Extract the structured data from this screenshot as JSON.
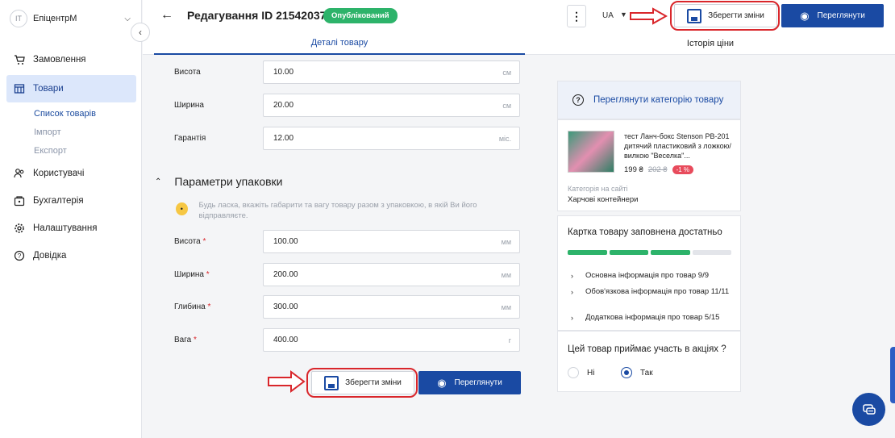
{
  "sidebar": {
    "org_initials": "IT",
    "org_name": "ЕпіцентрМ",
    "items": [
      {
        "label": "Замовлення",
        "icon": "cart-icon"
      },
      {
        "label": "Товари",
        "icon": "box-icon"
      },
      {
        "label": "Користувачі",
        "icon": "users-icon"
      },
      {
        "label": "Бухгалтерія",
        "icon": "wallet-icon"
      },
      {
        "label": "Налаштування",
        "icon": "gear-icon"
      },
      {
        "label": "Довідка",
        "icon": "help-icon"
      }
    ],
    "subitems": [
      "Список товарів",
      "Імпорт",
      "Експорт"
    ]
  },
  "header": {
    "title": "Редагування ID 21542037",
    "status_badge": "Опублікований",
    "lang": "UA",
    "save_label": "Зберегти зміни",
    "view_label": "Переглянути"
  },
  "tabs": [
    "Деталі товару",
    "Історія ціни"
  ],
  "dimensions": [
    {
      "label": "Висота",
      "value": "10.00",
      "unit": "см"
    },
    {
      "label": "Ширина",
      "value": "20.00",
      "unit": "см"
    },
    {
      "label": "Гарантія",
      "value": "12.00",
      "unit": "міс."
    }
  ],
  "packaging": {
    "title": "Параметри упаковки",
    "hint": "Будь ласка, вкажіть габарити та вагу товару разом з упаковкою, в якій Ви його відправляєте.",
    "fields": [
      {
        "label": "Висота",
        "value": "100.00",
        "unit": "мм"
      },
      {
        "label": "Ширина",
        "value": "200.00",
        "unit": "мм"
      },
      {
        "label": "Глибина",
        "value": "300.00",
        "unit": "мм"
      },
      {
        "label": "Вага",
        "value": "400.00",
        "unit": "г"
      }
    ],
    "required_mark": "*"
  },
  "footer": {
    "save_label": "Зберегти зміни",
    "view_label": "Переглянути"
  },
  "right": {
    "category_link": "Переглянути категорію товару",
    "product_title": "тест Ланч-бокс Stenson PB-201 дитячий пластиковий з ложкою/вилкою \"Веселка\"...",
    "price": "199 ₴",
    "old_price": "202 ₴",
    "discount": "-1 %",
    "category_label": "Категорія на сайті",
    "category_value": "Харчові контейнери",
    "fill_title": "Картка товару заповнена достатньо",
    "fill_progress_segments": [
      1,
      1,
      1,
      0
    ],
    "fill_items": [
      "Основна інформація про товар 9/9",
      "Обов'язкова інформація про товар 11/11",
      "Додаткова інформація про товар 5/15"
    ],
    "promo_title": "Цей товар приймає участь в акціях ?",
    "promo_no": "Ні",
    "promo_yes": "Так",
    "promo_selected": "Так"
  },
  "colors": {
    "primary": "#1a4aa3",
    "success": "#2db36a",
    "highlight": "#d9262b"
  }
}
